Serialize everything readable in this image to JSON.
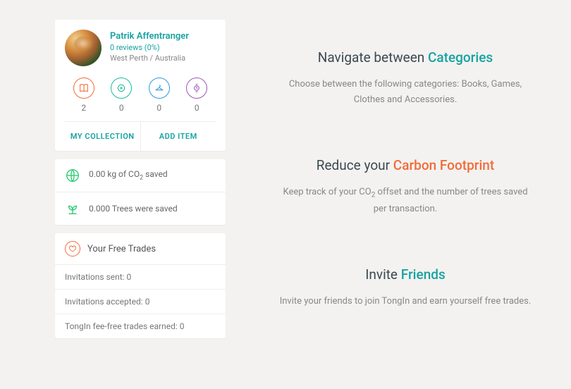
{
  "profile": {
    "name": "Patrik Affentranger",
    "reviews": "0 reviews (0%)",
    "location": "West Perth / Australia",
    "stats": {
      "books": "2",
      "games": "0",
      "clothes": "0",
      "accessories": "0"
    },
    "actions": {
      "my_collection": "MY COLLECTION",
      "add_item": "ADD ITEM"
    }
  },
  "carbon": {
    "co2_prefix": "0.00 kg of CO",
    "co2_sub": "2",
    "co2_suffix": " saved",
    "trees": "0.000 Trees were saved"
  },
  "free_trades": {
    "title": "Your Free Trades",
    "rows": {
      "sent": "Invitations sent: 0",
      "accepted": "Invitations accepted: 0",
      "earned": "TongIn fee-free trades earned: 0"
    }
  },
  "features": {
    "categories": {
      "title_pre": "Navigate between ",
      "title_accent": "Categories",
      "desc": "Choose between the following categories: Books, Games, Clothes and Accessories."
    },
    "carbon": {
      "title_pre": "Reduce your ",
      "title_accent": "Carbon Footprint",
      "desc_pre": "Keep track of your CO",
      "desc_sub": "2",
      "desc_post": " offset and the number of trees saved per transaction."
    },
    "friends": {
      "title_pre": "Invite ",
      "title_accent": "Friends",
      "desc": "Invite your friends to join TongIn and earn yourself free trades."
    }
  }
}
